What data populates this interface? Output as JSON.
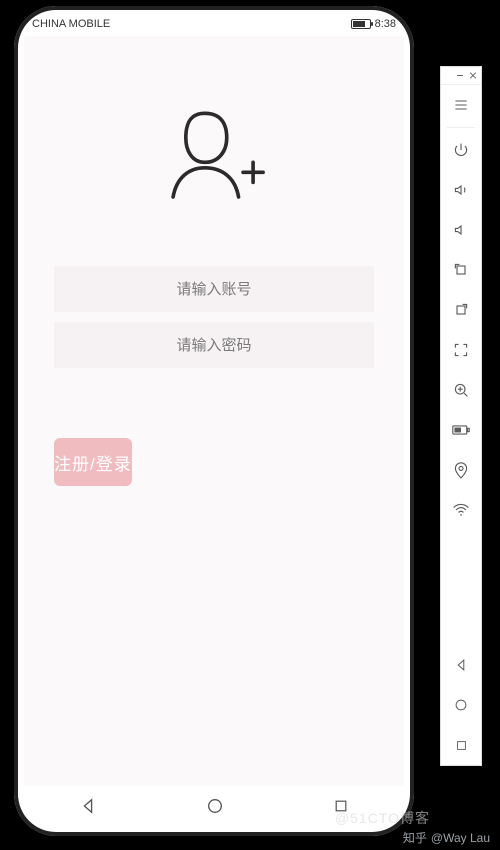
{
  "statusbar": {
    "carrier": "CHINA MOBILE",
    "time": "8:38"
  },
  "form": {
    "account_placeholder": "请输入账号",
    "password_placeholder": "请输入密码",
    "submit_label": "注册/登录"
  },
  "icons": {
    "user_add": "user-add-icon",
    "nav_back": "triangle-left",
    "nav_home": "circle",
    "nav_recent": "square",
    "tools": [
      "menu-icon",
      "power-icon",
      "volume-up-icon",
      "volume-down-icon",
      "rotate-left-icon",
      "rotate-right-icon",
      "crop-icon",
      "zoom-in-icon",
      "battery-icon",
      "location-icon",
      "wifi-icon",
      "triangle-left-icon",
      "circle-icon",
      "square-icon"
    ]
  },
  "watermark": {
    "faint": "@51CTO博客",
    "zhihu_label": "知乎",
    "author": "@Way Lau"
  }
}
